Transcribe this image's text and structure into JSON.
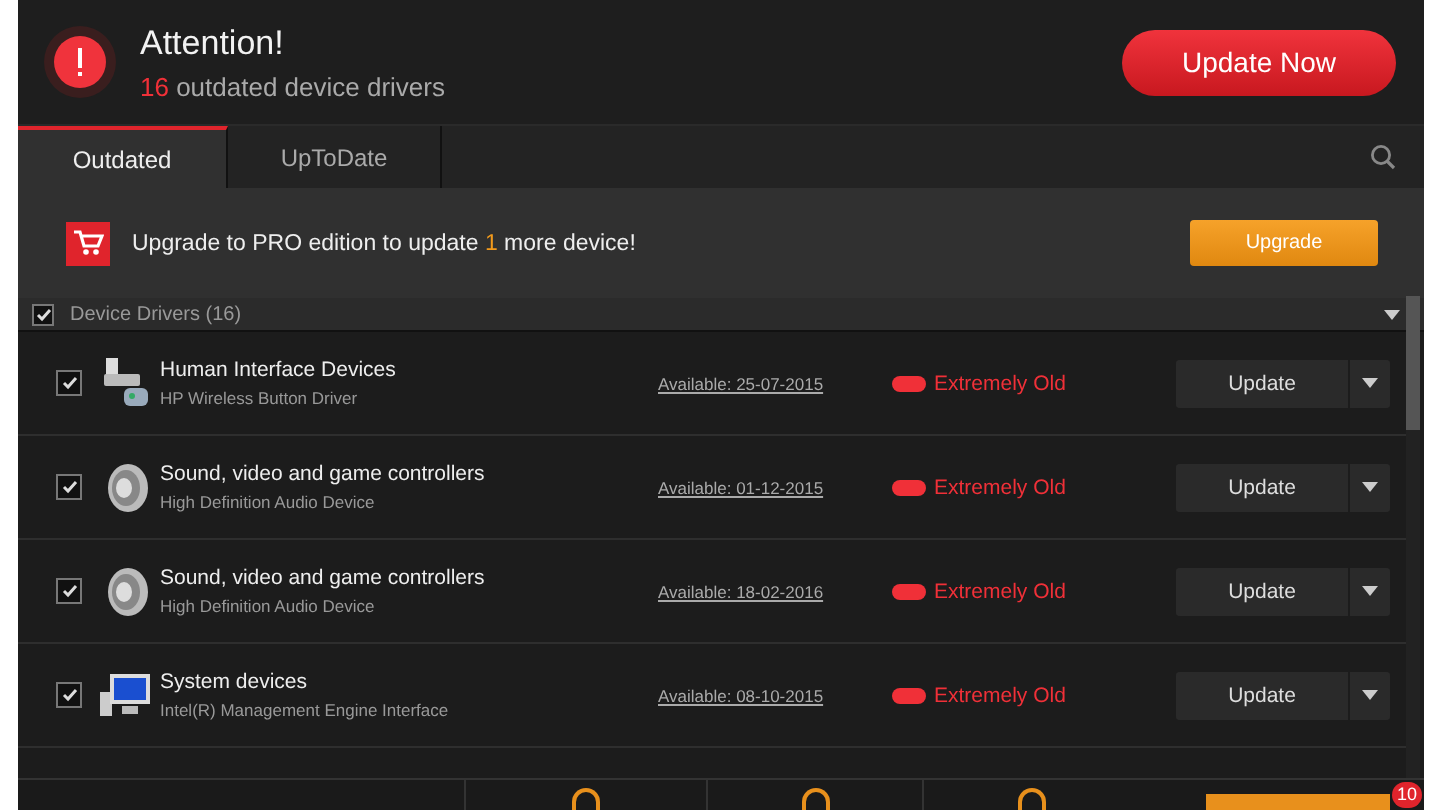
{
  "header": {
    "title": "Attention!",
    "count": "16",
    "subtitle": "outdated device drivers",
    "button": "Update Now"
  },
  "tabs": [
    {
      "label": "Outdated",
      "selected": true
    },
    {
      "label": "UpToDate",
      "selected": false
    }
  ],
  "banner": {
    "before": "Upgrade to PRO edition to update ",
    "count": "1",
    "after": " more device!",
    "button": "Upgrade"
  },
  "group": {
    "label": "Device Drivers (16)",
    "checked": true
  },
  "drivers": [
    {
      "kind": "hid",
      "category": "Human Interface Devices",
      "device": "HP Wireless Button Driver",
      "available": "Available: 25-07-2015",
      "status": "Extremely Old",
      "button": "Update",
      "checked": true
    },
    {
      "kind": "speaker",
      "category": "Sound, video and game controllers",
      "device": "High Definition Audio Device",
      "available": "Available: 01-12-2015",
      "status": "Extremely Old",
      "button": "Update",
      "checked": true
    },
    {
      "kind": "speaker",
      "category": "Sound, video and game controllers",
      "device": "High Definition Audio Device",
      "available": "Available: 18-02-2016",
      "status": "Extremely Old",
      "button": "Update",
      "checked": true
    },
    {
      "kind": "monitor",
      "category": "System devices",
      "device": "Intel(R) Management Engine Interface",
      "available": "Available: 08-10-2015",
      "status": "Extremely Old",
      "button": "Update",
      "checked": true
    }
  ],
  "footer": {
    "badge": "10"
  }
}
